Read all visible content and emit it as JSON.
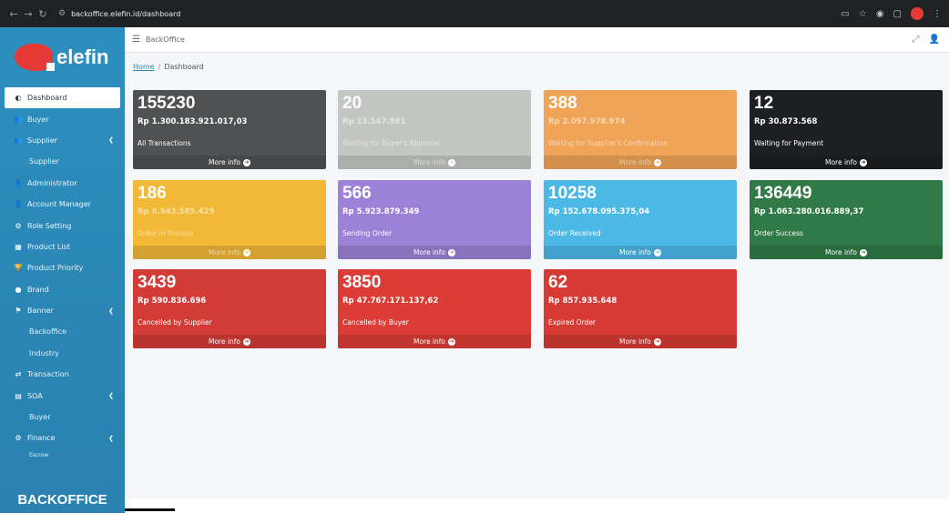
{
  "browser": {
    "url": "backoffice.elefin.id/dashboard",
    "nav_icons": [
      "←",
      "→",
      "↻"
    ]
  },
  "sidebar": {
    "logo_text": "elefin",
    "footer": "BACKOFFICE",
    "items": [
      {
        "label": "Dashboard",
        "icon": "◐",
        "icon_name": "dashboard-icon",
        "active": true
      },
      {
        "label": "Buyer",
        "icon": "👥",
        "icon_name": "users-icon"
      },
      {
        "label": "Supplier",
        "icon": "👥",
        "icon_name": "users-icon",
        "chevron": "❮"
      },
      {
        "label": "Supplier",
        "sub": true
      },
      {
        "label": "Administrator",
        "icon": "👤",
        "icon_name": "user-cog-icon"
      },
      {
        "label": "Account Manager",
        "icon": "👤",
        "icon_name": "user-tie-icon"
      },
      {
        "label": "Role Setting",
        "icon": "⚙",
        "icon_name": "users-cog-icon"
      },
      {
        "label": "Product List",
        "icon": "▦",
        "icon_name": "cubes-icon"
      },
      {
        "label": "Product Priority",
        "icon": "🏆",
        "icon_name": "trophy-icon"
      },
      {
        "label": "Brand",
        "icon": "●",
        "icon_name": "brand-icon"
      },
      {
        "label": "Banner",
        "icon": "⚑",
        "icon_name": "flag-icon",
        "chevron": "❮"
      },
      {
        "label": "Backoffice",
        "sub": true
      },
      {
        "label": "Industry",
        "sub": true
      },
      {
        "label": "Transaction",
        "icon": "⇄",
        "icon_name": "exchange-icon"
      },
      {
        "label": "SOA",
        "icon": "▤",
        "icon_name": "file-invoice-icon",
        "chevron": "❮"
      },
      {
        "label": "Buyer",
        "sub": true
      },
      {
        "label": "Finance",
        "icon": "⚙",
        "icon_name": "finance-icon",
        "chevron": "❮"
      },
      {
        "label": "Escrow",
        "sub": true
      }
    ]
  },
  "header": {
    "title": "BackOffice"
  },
  "breadcrumb": {
    "home": "Home",
    "separator": "/",
    "current": "Dashboard"
  },
  "cards": [
    {
      "count": "155230",
      "amount": "Rp 1.300.183.921.017,03",
      "label": "All Transactions",
      "more": "More info",
      "color": "#505153"
    },
    {
      "count": "20",
      "amount": "Rp 13.547.981",
      "label": "Waiting for Buyer's Approval",
      "more": "More info",
      "color": "#c3c6c2",
      "faded": true
    },
    {
      "count": "388",
      "amount": "Rp 2.097.978.974",
      "label": "Waiting for Supplier's Confirmation",
      "more": "More info",
      "color": "#f0a457",
      "faded": true
    },
    {
      "count": "12",
      "amount": "Rp 30.873.568",
      "label": "Waiting for Payment",
      "more": "More info",
      "color": "#1d1f22"
    },
    {
      "count": "186",
      "amount": "Rp 6.943.585.429",
      "label": "Order in Process",
      "more": "More info",
      "color": "#f2b838",
      "faded": true
    },
    {
      "count": "566",
      "amount": "Rp 5.923.879.349",
      "label": "Sending Order",
      "more": "More info",
      "color": "#9b82d6"
    },
    {
      "count": "10258",
      "amount": "Rp 152.678.095.375,04",
      "label": "Order Received",
      "more": "More info",
      "color": "#4cb8e6"
    },
    {
      "count": "136449",
      "amount": "Rp 1.063.280.016.889,37",
      "label": "Order Success",
      "more": "More info",
      "color": "#2f7a46"
    },
    {
      "count": "3439",
      "amount": "Rp 590.836.696",
      "label": "Cancelled by Supplier",
      "more": "More info",
      "color": "#d33b36"
    },
    {
      "count": "3850",
      "amount": "Rp 47.767.171.137,62",
      "label": "Cancelled by Buyer",
      "more": "More info",
      "color": "#db3d36"
    },
    {
      "count": "62",
      "amount": "Rp 857.935.648",
      "label": "Expired Order",
      "more": "More info",
      "color": "#d63a34"
    }
  ]
}
